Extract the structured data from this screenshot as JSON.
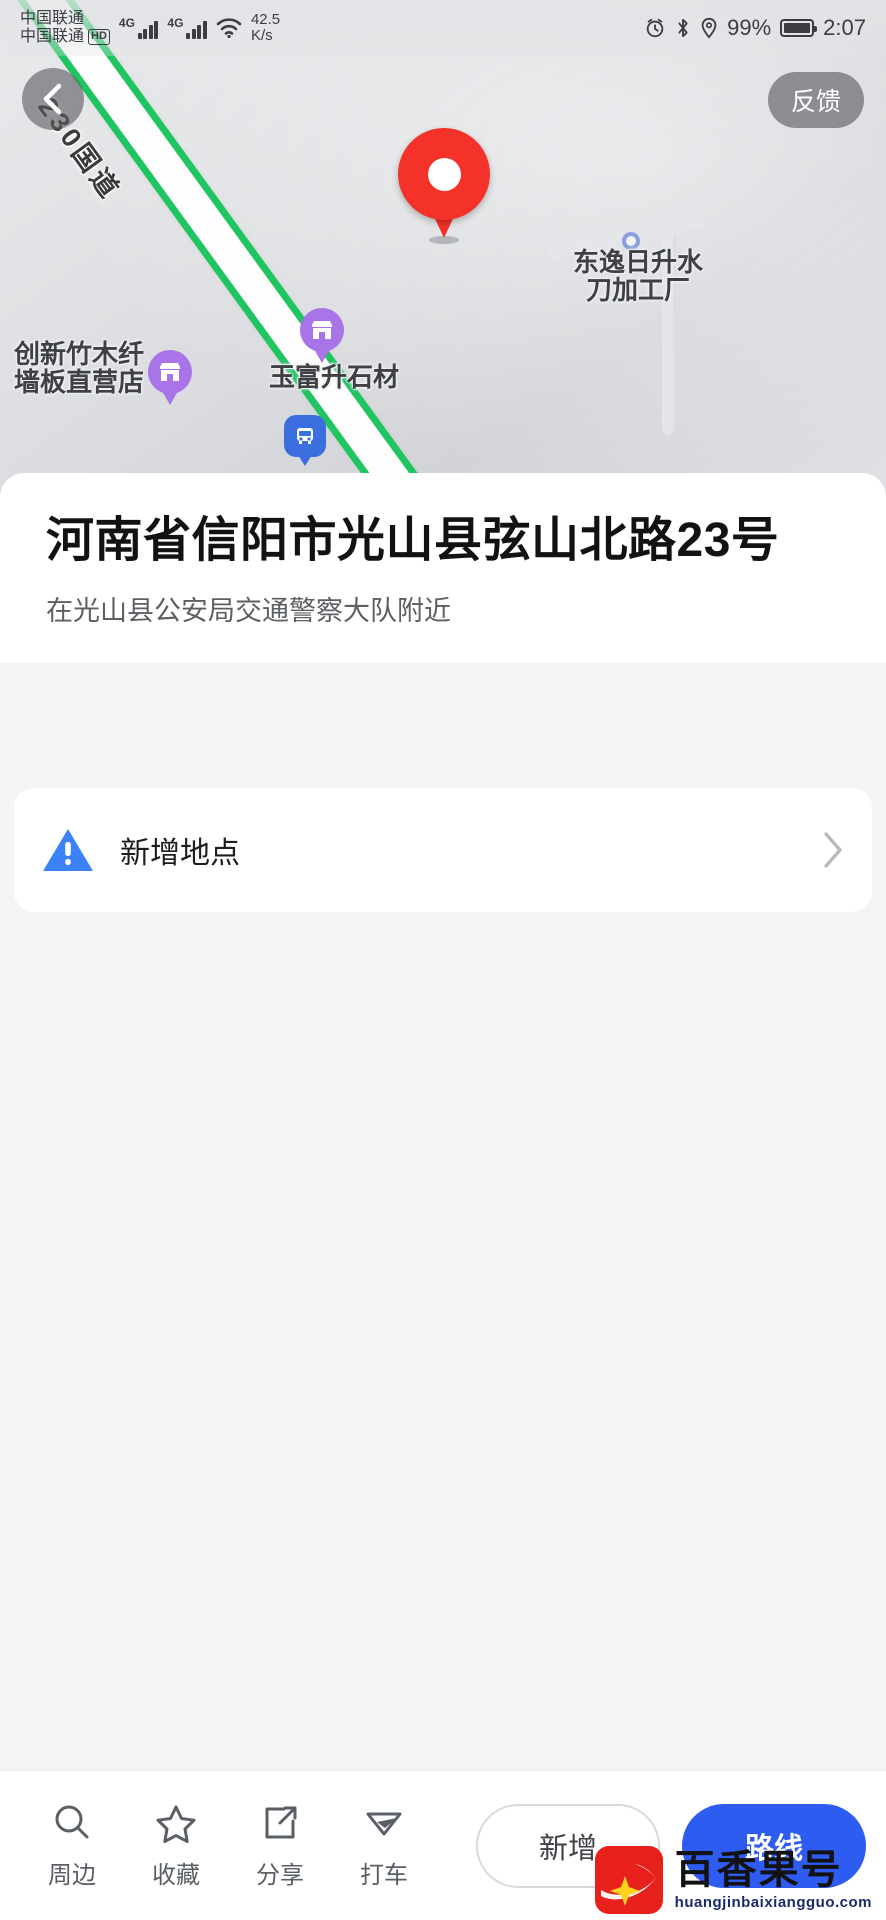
{
  "status_bar": {
    "carrier_line1": "中国联通",
    "carrier_line2": "中国联通",
    "hd_badge": "HD",
    "net_tag_1": "4G",
    "net_tag_2": "4G",
    "net_speed_value": "42.5",
    "net_speed_unit": "K/s",
    "battery_percent": "99%",
    "clock": "2:07",
    "icons": [
      "alarm-icon",
      "bluetooth-icon",
      "location-icon",
      "battery-icon"
    ]
  },
  "map": {
    "back_button": "back-arrow-icon",
    "feedback_label": "反馈",
    "road_label": "230国道",
    "main_pin": "selected-location-pin",
    "pois": [
      {
        "name": "创新竹木纤\n墙板直营店",
        "icon": "shop-icon"
      },
      {
        "name": "玉富升石材",
        "icon": "shop-icon"
      },
      {
        "name": "东逸日升水\n刀加工厂",
        "icon": "circle-dot-icon"
      },
      {
        "name": "",
        "icon": "bus-stop-icon"
      }
    ]
  },
  "detail": {
    "address_title": "河南省信阳市光山县弦山北路23号",
    "address_subtitle": "在光山县公安局交通警察大队附近",
    "add_point_label": "新增地点",
    "add_point_icon": "warning-triangle-icon",
    "add_point_chevron": "chevron-right-icon"
  },
  "bottom_bar": {
    "tools": [
      {
        "label": "周边",
        "icon": "search-icon"
      },
      {
        "label": "收藏",
        "icon": "star-icon"
      },
      {
        "label": "分享",
        "icon": "share-icon"
      },
      {
        "label": "打车",
        "icon": "taxi-icon"
      }
    ],
    "secondary_action": "新增",
    "primary_action": "路线"
  },
  "watermark": {
    "brand_cn": "百香果号",
    "brand_url": "huangjinbaixiangguo.com"
  },
  "colors": {
    "pin_red": "#f5322a",
    "poi_purple": "#a974e8",
    "bus_blue": "#3b6fe0",
    "road_green": "#20c461",
    "primary_blue": "#2f5cf0",
    "warning_blue": "#3b82f6",
    "watermark_red": "#e8201c"
  }
}
